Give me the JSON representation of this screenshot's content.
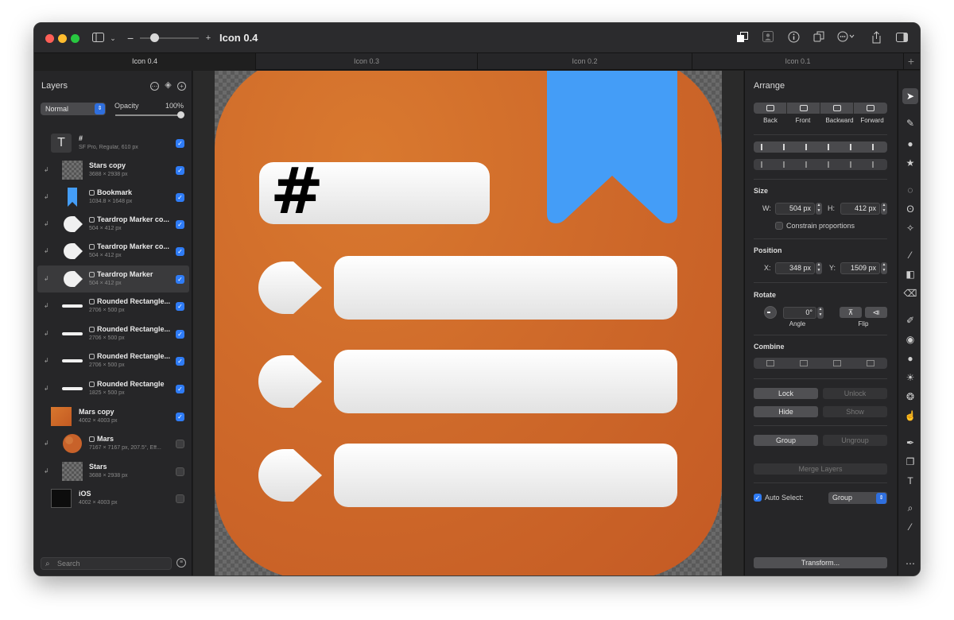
{
  "window": {
    "document_title": "Icon 0.4",
    "zoom_minus": "−",
    "zoom_plus": "+"
  },
  "tabs": [
    {
      "label": "Icon 0.4",
      "active": true
    },
    {
      "label": "Icon 0.3",
      "active": false
    },
    {
      "label": "Icon 0.2",
      "active": false
    },
    {
      "label": "Icon 0.1",
      "active": false
    }
  ],
  "tab_add": "+",
  "layers_panel": {
    "title": "Layers",
    "blend_mode": "Normal",
    "opacity_label": "Opacity",
    "opacity_value": "100%",
    "opacity_level": 1.0,
    "search_placeholder": "Search",
    "layers": [
      {
        "name": "#",
        "meta": "SF Pro, Regular, 610 px",
        "visible": true,
        "thumb": "text"
      },
      {
        "name": "Stars copy",
        "meta": "3688 × 2938 px",
        "visible": true,
        "thumb": "checker"
      },
      {
        "name": "Bookmark",
        "meta": "1034.8 × 1648 px",
        "visible": true,
        "thumb": "bookmark"
      },
      {
        "name": "Teardrop Marker co...",
        "meta": "504 × 412 px",
        "visible": true,
        "thumb": "drop"
      },
      {
        "name": "Teardrop Marker co...",
        "meta": "504 × 412 px",
        "visible": true,
        "thumb": "drop"
      },
      {
        "name": "Teardrop Marker",
        "meta": "504 × 412 px",
        "visible": true,
        "thumb": "drop",
        "selected": true
      },
      {
        "name": "Rounded Rectangle...",
        "meta": "2706 × 500 px",
        "visible": true,
        "thumb": "bar"
      },
      {
        "name": "Rounded Rectangle...",
        "meta": "2706 × 500 px",
        "visible": true,
        "thumb": "bar"
      },
      {
        "name": "Rounded Rectangle...",
        "meta": "2706 × 500 px",
        "visible": true,
        "thumb": "bar"
      },
      {
        "name": "Rounded Rectangle",
        "meta": "1825 × 500 px",
        "visible": true,
        "thumb": "bar"
      },
      {
        "name": "Mars copy",
        "meta": "4002 × 4003 px",
        "visible": true,
        "thumb": "orange"
      },
      {
        "name": "Mars",
        "meta": "7167 × 7167 px, 207.5°, Eff...",
        "visible": false,
        "thumb": "mars"
      },
      {
        "name": "Stars",
        "meta": "3688 × 2938 px",
        "visible": false,
        "thumb": "checker"
      },
      {
        "name": "iOS",
        "meta": "4002 × 4003 px",
        "visible": false,
        "thumb": "black"
      }
    ]
  },
  "canvas": {
    "hash_text": "#",
    "colors": {
      "icon_orange": "#d06b2a",
      "bookmark_blue": "#449df7",
      "bar_white": "#f2f2f2"
    }
  },
  "arrange_panel": {
    "title": "Arrange",
    "order_buttons": [
      "Back",
      "Front",
      "Backward",
      "Forward"
    ],
    "size": {
      "title": "Size",
      "w_label": "W:",
      "w_value": "504 px",
      "h_label": "H:",
      "h_value": "412 px",
      "constrain_label": "Constrain proportions"
    },
    "position": {
      "title": "Position",
      "x_label": "X:",
      "x_value": "348 px",
      "y_label": "Y:",
      "y_value": "1509 px"
    },
    "rotate": {
      "title": "Rotate",
      "angle_value": "0°",
      "angle_label": "Angle",
      "flip_label": "Flip"
    },
    "combine": {
      "title": "Combine"
    },
    "lock_label": "Lock",
    "unlock_label": "Unlock",
    "hide_label": "Hide",
    "show_label": "Show",
    "group_label": "Group",
    "ungroup_label": "Ungroup",
    "merge_label": "Merge Layers",
    "auto_select_label": "Auto Select:",
    "auto_select_value": "Group",
    "transform_label": "Transform..."
  },
  "tools": [
    "arrow-tool-icon",
    "paint-bucket-icon",
    "shapes-icon",
    "star-icon",
    "ellipse-select-icon",
    "lasso-icon",
    "magic-wand-icon",
    "brush-icon",
    "gradient-icon",
    "eraser-icon",
    "pencil-icon",
    "clone-icon",
    "blur-icon",
    "sun-icon",
    "paint-drops-icon",
    "finger-icon",
    "pen-icon",
    "shape-stack-icon",
    "text-tool-icon",
    "zoom-icon",
    "eyedropper-icon",
    "more-icon"
  ]
}
